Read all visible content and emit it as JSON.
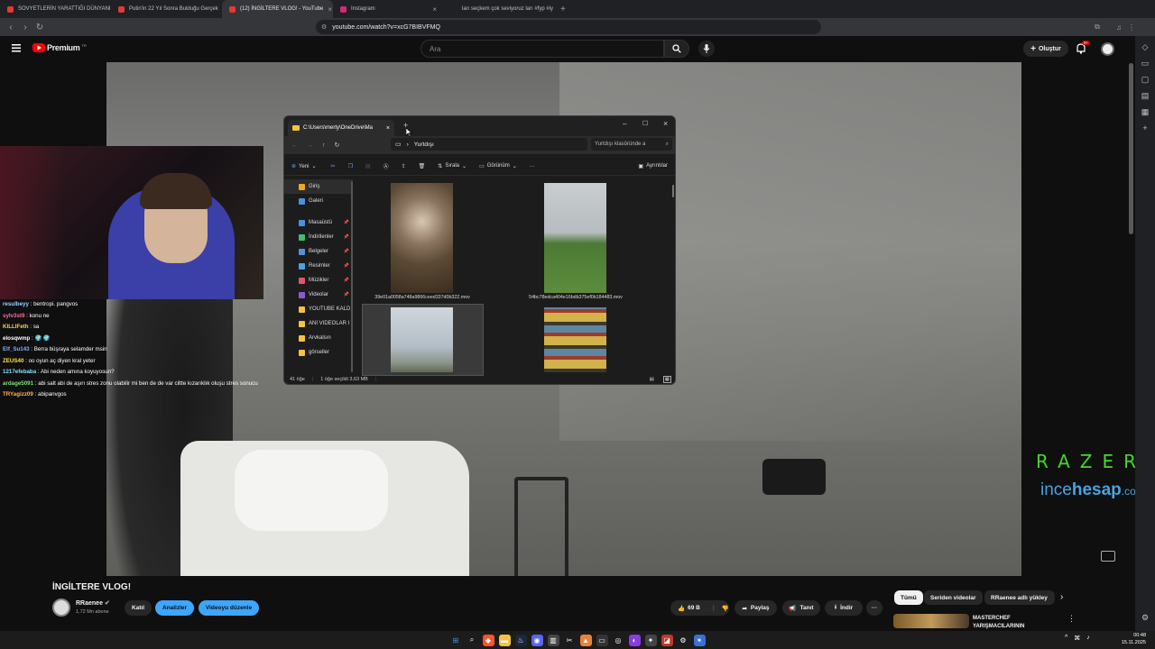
{
  "browser": {
    "tabs": [
      {
        "label": "SOVYETLERİN YARATTIĞI DÜNYANIN",
        "color": "#e53935"
      },
      {
        "label": "Putin'in 22 Yıl Sonra Bulduğu Gerçek",
        "color": "#e53935"
      },
      {
        "label": "(12) İNGİLTERE VLOG! - YouTube",
        "color": "#e53935",
        "active": true
      },
      {
        "label": "Instagram",
        "color": "#d62976"
      },
      {
        "label": "ları seçkem çok seviyoruz ları #fyp #iy",
        "color": "#222222"
      }
    ],
    "url": "youtube.com/watch?v=xcG7BIBVFMQ"
  },
  "youtube": {
    "logo": "Premium",
    "logo_sup": "TR",
    "search_placeholder": "Ara",
    "create_label": "Oluştur",
    "notification_count": "9+",
    "accent": "#ff0000"
  },
  "chat": [
    {
      "user": "resulbeyy",
      "msg": "bentropi. pangvos",
      "color": "#9ad1ff"
    },
    {
      "user": "sylv3st9",
      "msg": "konu ne",
      "color": "#ff6b9a"
    },
    {
      "user": "KILLIFeth",
      "msg": "sa",
      "color": "#ffd24a"
    },
    {
      "user": "elosqwmp",
      "msg": "🌍 🌍",
      "color": "#ffffff"
    },
    {
      "user": "Elf_Su143",
      "msg": "Berra büşraya selamder msin",
      "color": "#7fb3ff"
    },
    {
      "user": "ZEUS40",
      "msg": "oo oyun aç diyen kral yeter",
      "color": "#ffe14a"
    },
    {
      "user": "1217efebaba",
      "msg": "Abi neden amına koyuyosun?",
      "color": "#7fe0ff"
    },
    {
      "user": "ardage5091",
      "msg": "abi salt abi de aşırı stres zonu olabilir mi ben de de var ciltte kızarıklık oluşu stres sonucu",
      "color": "#7ee07e"
    },
    {
      "user": "TRYagizz09",
      "msg": "abipanvgos",
      "color": "#ffb347"
    }
  ],
  "overlay": {
    "razer": "RAZER",
    "ince": "ince",
    "hesap": "hesap",
    "com": ".com"
  },
  "explorer": {
    "tab_title": "C:\\Users\\merty\\OneDrive\\Ma",
    "path_current": "Yurtdışı",
    "search_placeholder": "Yurtdışı klasöründe a",
    "toolbar": {
      "new": "Yeni",
      "sort": "Sırala",
      "view": "Görünüm",
      "details": "Ayrıntılar"
    },
    "sidebar": [
      {
        "label": "Giriş",
        "icon": "home-icon",
        "color": "#f5a623"
      },
      {
        "label": "Galeri",
        "icon": "gallery-icon",
        "color": "#4a90e2"
      },
      {
        "label": "Masaüstü",
        "icon": "desktop-icon",
        "color": "#4a90e2",
        "pinned": true
      },
      {
        "label": "İndirilenler",
        "icon": "download-icon",
        "color": "#3fbf6f",
        "pinned": true
      },
      {
        "label": "Belgeler",
        "icon": "documents-icon",
        "color": "#5a8fd6",
        "pinned": true
      },
      {
        "label": "Resimler",
        "icon": "pictures-icon",
        "color": "#4aa3df",
        "pinned": true
      },
      {
        "label": "Müzikler",
        "icon": "music-icon",
        "color": "#e0556a",
        "pinned": true
      },
      {
        "label": "Videolar",
        "icon": "videos-icon",
        "color": "#8a5ad6",
        "pinned": true
      },
      {
        "label": "YOUTUBE KALD",
        "icon": "folder-icon",
        "color": "#f5c242"
      },
      {
        "label": "ANI VIDEOLAR I",
        "icon": "folder-icon",
        "color": "#f5c242"
      },
      {
        "label": "Arvkalsın",
        "icon": "folder-icon",
        "color": "#f5c242"
      },
      {
        "label": "görseller",
        "icon": "folder-icon",
        "color": "#f5c242"
      }
    ],
    "files": [
      {
        "name": "39e01a0058a748a9866ceed337d0b322.mov",
        "kind": "witch"
      },
      {
        "name": "54bc78edca404e16bdb375ef0b184483.mov",
        "kind": "field"
      },
      {
        "name": "",
        "kind": "sky"
      },
      {
        "name": "",
        "kind": "tiles"
      }
    ],
    "status": {
      "count": "41 öğe",
      "selected": "1 öğe seçildi 3,63 MB"
    }
  },
  "video": {
    "title": "İNGİLTERE VLOG!",
    "channel": "RRaenee",
    "subscribers": "1,72 Mn abone",
    "join_label": "Katıl",
    "analytics_label": "Analizler",
    "edit_label": "Videoyu düzenle",
    "likes": "69 B",
    "share_label": "Paylaş",
    "promote_label": "Tanıt",
    "download_label": "İndir"
  },
  "recommend": {
    "chips": [
      "Tümü",
      "Seriden videolar",
      "RRaenee adlı yükley"
    ],
    "item_title": "MASTERCHEF",
    "item_sub": "YARIŞMACILARININ"
  },
  "system": {
    "time": "00:48",
    "date": "15.11.2025"
  }
}
